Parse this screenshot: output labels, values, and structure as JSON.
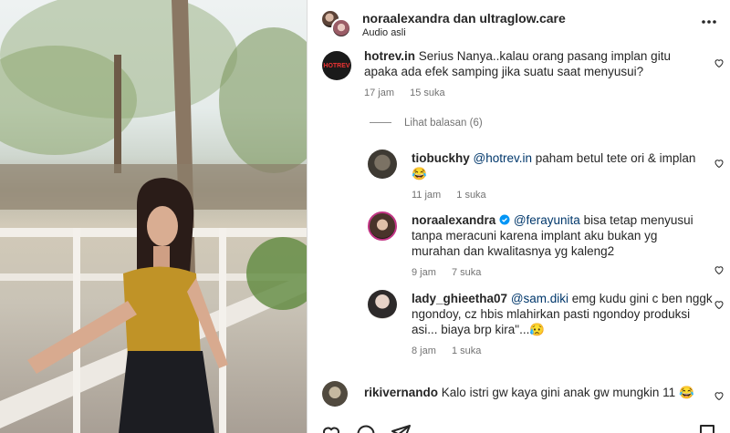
{
  "post": {
    "header": {
      "title": "noraalexandra dan ultraglow.care",
      "subtitle": "Audio asli",
      "more_icon": "more-horizontal-icon"
    },
    "comments": [
      {
        "username": "hotrev.in",
        "avatar_label": "HOTREV",
        "text": "Serius Nanya..kalau orang pasang implan gitu apaka ada efek samping jika suatu saat menyusui?",
        "time": "17 jam",
        "likes": "15 suka"
      },
      {
        "username": "tiobuckhy",
        "mention": "@hotrev.in",
        "text": "paham betul tete ori & implan",
        "emoji": "😂",
        "time": "11 jam",
        "likes": "1 suka"
      },
      {
        "username": "noraalexandra",
        "verified": true,
        "mention": "@ferayunita",
        "text": "bisa tetap menyusui tanpa meracuni karena implant aku bukan yg murahan dan kwalitasnya yg kaleng2",
        "time": "9 jam",
        "likes": "7 suka"
      },
      {
        "username": "lady_ghieetha07",
        "mention": "@sam.diki",
        "text": "emg kudu gini c ben nggk ngondoy, cz hbis mlahirkan pasti ngondoy produksi asi... biaya brp kira\"...",
        "emoji": "😥",
        "time": "8 jam",
        "likes": "1 suka"
      },
      {
        "username": "rikivernando",
        "text": "Kalo istri gw kaya gini anak gw mungkin 11",
        "emoji": "😂"
      }
    ],
    "view_replies": "Lihat balasan (6)",
    "icons": {
      "like": "heart-icon",
      "comment": "comment-icon",
      "share": "send-icon",
      "save": "bookmark-icon"
    },
    "colors": {
      "text": "#262626",
      "meta": "#737373",
      "mention": "#00376b",
      "verified": "#0095f6"
    }
  }
}
